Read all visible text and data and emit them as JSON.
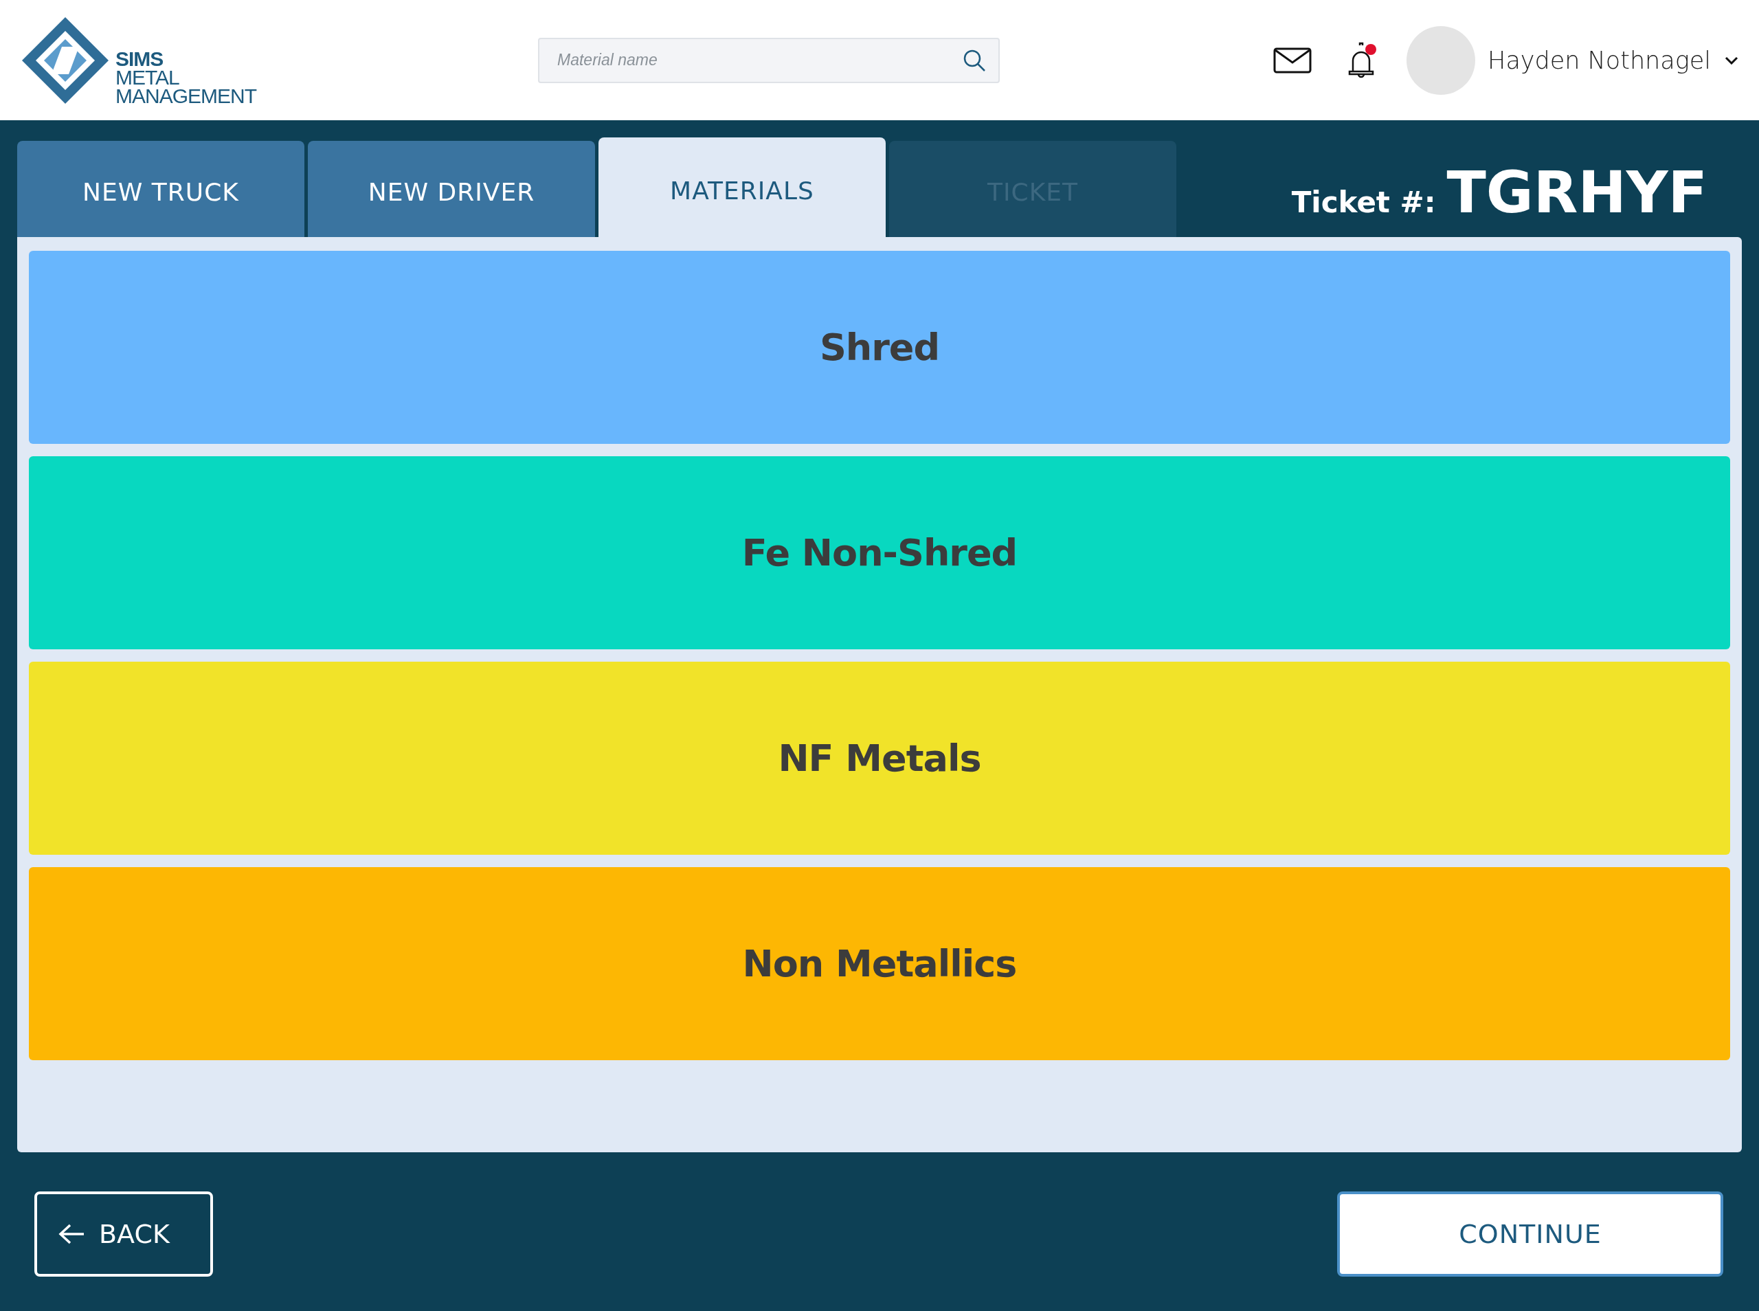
{
  "logo": {
    "lines": [
      "SIMS",
      "METAL",
      "MANAGEMENT"
    ]
  },
  "search": {
    "placeholder": "Material name"
  },
  "notifications": {
    "unread": true
  },
  "user": {
    "name": "Hayden Nothnagel"
  },
  "tabs": [
    {
      "label": "NEW TRUCK",
      "selected": false,
      "disabled": false
    },
    {
      "label": "NEW DRIVER",
      "selected": false,
      "disabled": false
    },
    {
      "label": "MATERIALS",
      "selected": true,
      "disabled": false
    },
    {
      "label": "TICKET",
      "selected": false,
      "disabled": true
    }
  ],
  "ticket": {
    "label": "Ticket #:",
    "number": "TGRHYF"
  },
  "materials": [
    {
      "name": "Shred",
      "color": "#68b6fd"
    },
    {
      "name": "Fe Non-Shred",
      "color": "#08d8c0"
    },
    {
      "name": "NF Metals",
      "color": "#f1e329"
    },
    {
      "name": "Non Metallics",
      "color": "#fdb703"
    }
  ],
  "buttons": {
    "back": "BACK",
    "continue": "CONTINUE"
  }
}
